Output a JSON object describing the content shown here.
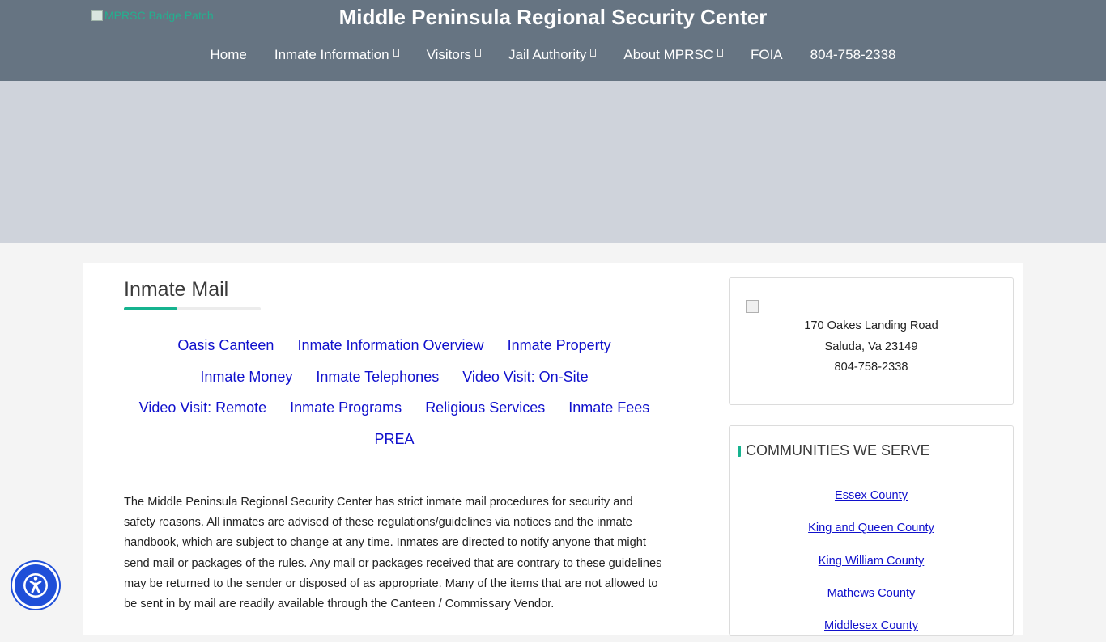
{
  "header": {
    "logo_alt": "MPRSC Badge Patch",
    "title": "Middle Peninsula Regional Security Center",
    "nav": [
      {
        "label": "Home",
        "dropdown": false
      },
      {
        "label": "Inmate Information",
        "dropdown": true
      },
      {
        "label": "Visitors",
        "dropdown": true
      },
      {
        "label": "Jail Authority",
        "dropdown": true
      },
      {
        "label": "About MPRSC",
        "dropdown": true
      },
      {
        "label": "FOIA",
        "dropdown": false
      },
      {
        "label": "804-758-2338",
        "dropdown": false
      }
    ]
  },
  "main": {
    "title": "Inmate Mail",
    "links": [
      "Oasis Canteen",
      "Inmate Information Overview",
      "Inmate Property",
      "Inmate Money",
      "Inmate Telephones",
      "Video Visit: On-Site",
      "Video Visit: Remote",
      "Inmate Programs",
      "Religious Services",
      "Inmate Fees",
      "PREA"
    ],
    "body": "The Middle Peninsula Regional Security Center has strict inmate mail procedures for security and safety reasons. All inmates are advised of these regulations/guidelines via notices and the inmate handbook, which are subject to change at any time. Inmates are directed to notify anyone that might send mail or packages of the rules. Any mail or packages received that are contrary to these guidelines may be returned to the sender or disposed of as appropriate. Many of the items that are not allowed to be sent in by mail are readily available through the Canteen / Commissary Vendor."
  },
  "sidebar": {
    "address": {
      "street": "170 Oakes Landing Road",
      "city": "Saluda, Va 23149",
      "phone": "804-758-2338"
    },
    "communities": {
      "heading": "COMMUNITIES WE SERVE",
      "items": [
        "Essex County",
        "King and Queen County",
        "King William County",
        "Mathews County",
        "Middlesex County"
      ]
    }
  },
  "colors": {
    "header_bg": "#667482",
    "hero_bg": "#cfd3db",
    "accent": "#16b38f",
    "link": "#1010cc",
    "accessibility_button": "#1f4fd8"
  },
  "icons": {
    "accessibility": "accessibility-icon"
  }
}
